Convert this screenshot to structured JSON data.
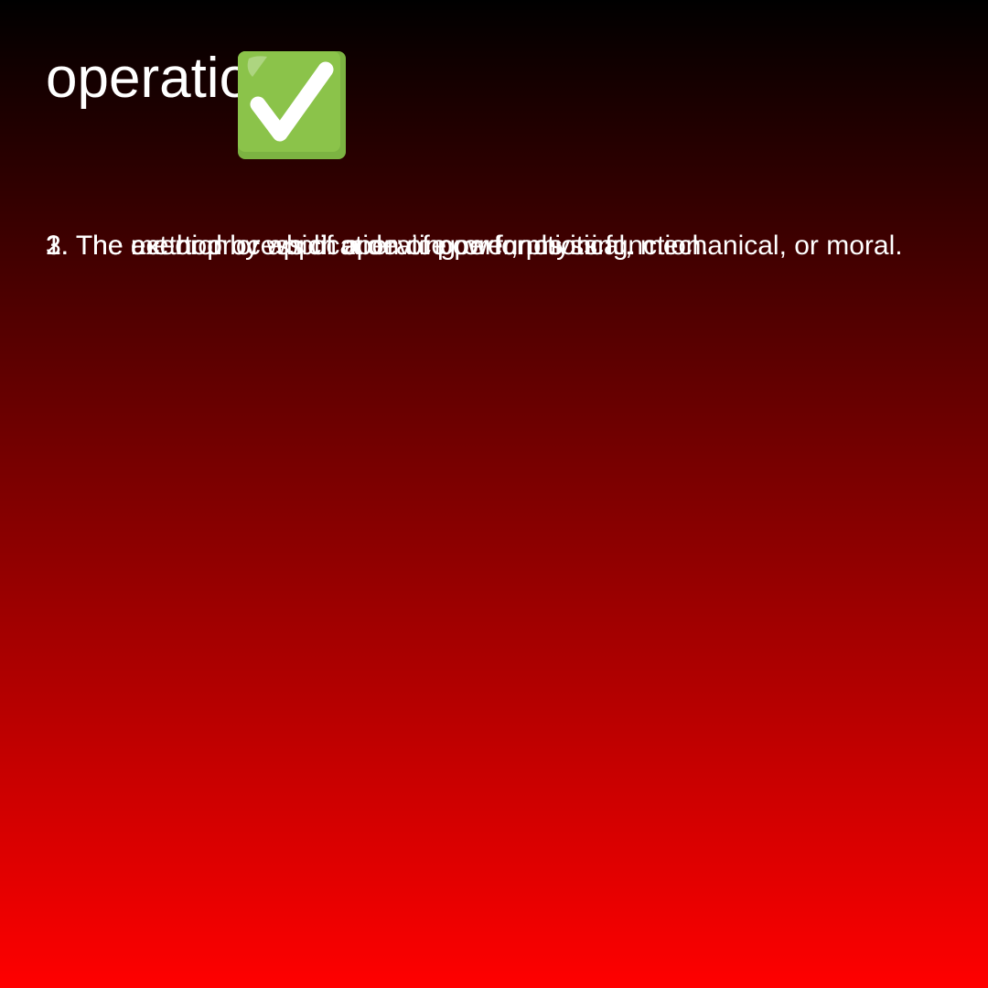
{
  "title": {
    "text": "operation",
    "icon": "check-mark-button-icon",
    "icon_color": "#7cb342"
  },
  "definitions": [
    {
      "number": "1.",
      "text": "The act or process of operating or functioning."
    },
    {
      "number": "2.",
      "text": "The exertion or application of power, physical, mechanical, or moral."
    },
    {
      "number": "3.",
      "text": "The method by which a device performs its function."
    }
  ],
  "colors": {
    "gradient_top": "#000000",
    "gradient_bottom": "#ff0000",
    "text": "#ffffff"
  }
}
